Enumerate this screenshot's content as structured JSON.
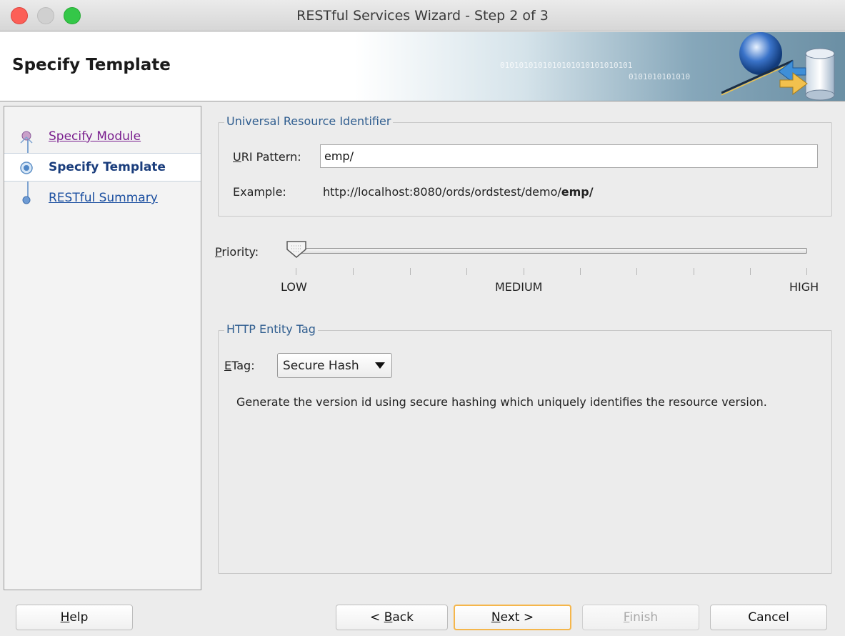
{
  "window": {
    "title": "RESTful Services Wizard - Step 2 of 3"
  },
  "header": {
    "title": "Specify Template",
    "binary_art_1": "0101010101010101010101010101",
    "binary_art_2": "0101010101010"
  },
  "steps": [
    {
      "label": "Specify Module",
      "state": "visited"
    },
    {
      "label": "Specify Template",
      "state": "current"
    },
    {
      "label": "RESTful Summary",
      "state": "pending"
    }
  ],
  "uri_group": {
    "legend": "Universal Resource Identifier",
    "uri_label_mnemonic": "U",
    "uri_label_rest": "RI Pattern:",
    "uri_value": "emp/",
    "example_label": "Example:",
    "example_prefix": "http://localhost:8080/ords/ordstest/demo/",
    "example_bold": "emp/"
  },
  "priority": {
    "label_mnemonic": "P",
    "label_rest": "riority:",
    "min_label": "LOW",
    "mid_label": "MEDIUM",
    "max_label": "HIGH",
    "level_fraction": 0
  },
  "etag_group": {
    "legend": "HTTP Entity Tag",
    "label_mnemonic": "E",
    "label_rest": "Tag:",
    "selected": "Secure Hash",
    "description": "Generate the version id using secure hashing which uniquely identifies the resource version."
  },
  "buttons": {
    "help_mnemonic": "H",
    "help_rest": "elp",
    "back_prefix": "< ",
    "back_mnemonic": "B",
    "back_rest": "ack",
    "next_mnemonic": "N",
    "next_rest": "ext >",
    "finish_mnemonic": "F",
    "finish_rest": "inish",
    "cancel": "Cancel"
  },
  "colors": {
    "legend_text": "#2f5d8f",
    "default_button_border": "#f5b64b",
    "visited_link": "#7a1f8e",
    "link": "#1b4fa0"
  }
}
